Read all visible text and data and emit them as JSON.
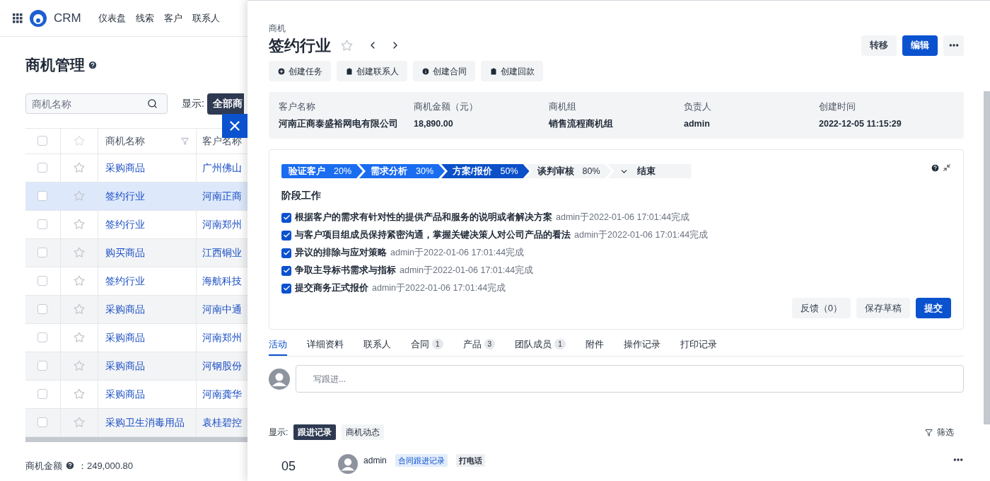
{
  "topbar": {
    "brand": "CRM",
    "nav": [
      "仪表盘",
      "线索",
      "客户",
      "联系人"
    ]
  },
  "page": {
    "title": "商机管理",
    "search": {
      "placeholder": "商机名称"
    },
    "show_label": "显示:",
    "filter_button": "全部商",
    "table": {
      "columns": [
        "商机名称",
        "客户名称"
      ],
      "all_checked": false,
      "rows": [
        {
          "name": "采购商品",
          "customer": "广州佛山",
          "selected": false,
          "checked": false,
          "starred": false
        },
        {
          "name": "签约行业",
          "customer": "河南正商",
          "selected": true,
          "checked": false,
          "starred": false
        },
        {
          "name": "签约行业",
          "customer": "河南郑州",
          "selected": false,
          "checked": false,
          "starred": false
        },
        {
          "name": "购买商品",
          "customer": "江西铜业",
          "selected": false,
          "checked": false,
          "starred": false
        },
        {
          "name": "签约行业",
          "customer": "海航科技",
          "selected": false,
          "checked": false,
          "starred": false
        },
        {
          "name": "采购商品",
          "customer": "河南中通",
          "selected": false,
          "checked": false,
          "starred": false
        },
        {
          "name": "采购商品",
          "customer": "河南郑州",
          "selected": false,
          "checked": false,
          "starred": false
        },
        {
          "name": "采购商品",
          "customer": "河钢股份",
          "selected": false,
          "checked": false,
          "starred": false
        },
        {
          "name": "采购商品",
          "customer": "河南龚华",
          "selected": false,
          "checked": false,
          "starred": false
        },
        {
          "name": "采购卫生消毒用品",
          "customer": "袁桂碧控",
          "selected": false,
          "checked": false,
          "starred": false
        }
      ]
    },
    "total_label": "商机金额",
    "total_value": "：249,000.80"
  },
  "drawer": {
    "kind_label": "商机",
    "title": "签约行业",
    "starred": false,
    "header_buttons": [
      {
        "label": "转移",
        "primary": false
      },
      {
        "label": "编辑",
        "primary": true
      }
    ],
    "actions": [
      "创建任务",
      "创建联系人",
      "创建合同",
      "创建回款"
    ],
    "summary": [
      {
        "label": "客户名称",
        "value": "河南正商泰盛裕网电有限公司"
      },
      {
        "label": "商机金额（元）",
        "value": "18,890.00"
      },
      {
        "label": "商机组",
        "value": "销售流程商机组"
      },
      {
        "label": "负责人",
        "value": "admin"
      },
      {
        "label": "创建时间",
        "value": "2022-12-05 11:15:29"
      }
    ],
    "stages": [
      {
        "name": "验证客户",
        "percent": "20%",
        "kind": "done"
      },
      {
        "name": "需求分析",
        "percent": "30%",
        "kind": "done"
      },
      {
        "name": "方案/报价",
        "percent": "50%",
        "kind": "current"
      },
      {
        "name": "谈判审核",
        "percent": "80%",
        "kind": "todo"
      },
      {
        "name": "结束",
        "kind": "end"
      }
    ],
    "work_title": "阶段工作",
    "tasks": [
      {
        "text": "根据客户的需求有针对性的提供产品和服务的说明或者解决方案",
        "meta": "admin于2022-01-06 17:01:44完成",
        "checked": true
      },
      {
        "text": "与客户项目组成员保持紧密沟通，掌握关键决策人对公司产品的看法",
        "meta": "admin于2022-01-06 17:01:44完成",
        "checked": true
      },
      {
        "text": "异议的排除与应对策略",
        "meta": "admin于2022-01-06 17:01:44完成",
        "checked": true
      },
      {
        "text": "争取主导标书需求与指标",
        "meta": "admin于2022-01-06 17:01:44完成",
        "checked": true
      },
      {
        "text": "提交商务正式报价",
        "meta": "admin于2022-01-06 17:01:44完成",
        "checked": true
      }
    ],
    "stage_buttons": [
      {
        "label": "反馈（0）",
        "primary": false
      },
      {
        "label": "保存草稿",
        "primary": false
      },
      {
        "label": "提交",
        "primary": true
      }
    ],
    "tabs": [
      {
        "label": "活动",
        "selected": true
      },
      {
        "label": "详细资料",
        "selected": false
      },
      {
        "label": "联系人",
        "selected": false
      },
      {
        "label": "合同",
        "count": "1",
        "selected": false
      },
      {
        "label": "产品",
        "count": "3",
        "selected": false
      },
      {
        "label": "团队成员",
        "count": "1",
        "selected": false
      },
      {
        "label": "附件",
        "selected": false
      },
      {
        "label": "操作记录",
        "selected": false
      },
      {
        "label": "打印记录",
        "selected": false
      }
    ],
    "followup": {
      "placeholder": "写跟进..."
    },
    "show_label": "显示:",
    "filters": [
      {
        "label": "跟进记录",
        "selected": true
      },
      {
        "label": "商机动态",
        "selected": false
      }
    ],
    "filter_button": "筛选",
    "activity": {
      "day": "05",
      "user": "admin",
      "tags": [
        {
          "label": "合同跟进记录",
          "kind": "blue"
        },
        {
          "label": "打电话",
          "kind": "gray"
        }
      ]
    }
  }
}
